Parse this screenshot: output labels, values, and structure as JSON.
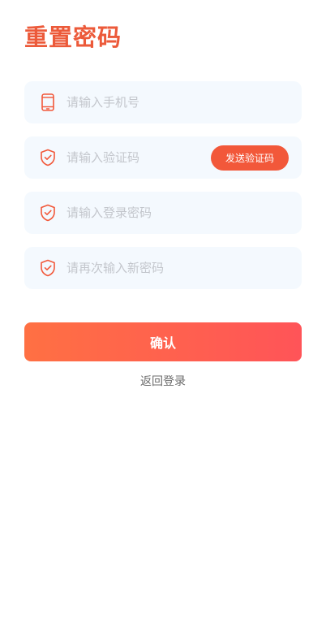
{
  "page": {
    "title": "重置密码"
  },
  "colors": {
    "accent": "#f2583a",
    "title": "#ec5a3a",
    "field_bg": "#f4f9fe",
    "placeholder": "#c3c6cc",
    "button_gradient_start": "#ff7043",
    "button_gradient_end": "#ff5458",
    "link": "#6b6b6b"
  },
  "form": {
    "phone": {
      "placeholder": "请输入手机号",
      "value": "",
      "icon": "phone-icon"
    },
    "code": {
      "placeholder": "请输入验证码",
      "value": "",
      "icon": "shield-check-icon",
      "send_label": "发送验证码"
    },
    "password": {
      "placeholder": "请输入登录密码",
      "value": "",
      "icon": "shield-check-icon"
    },
    "confirm_password": {
      "placeholder": "请再次输入新密码",
      "value": "",
      "icon": "shield-check-icon"
    }
  },
  "actions": {
    "confirm_label": "确认",
    "back_label": "返回登录"
  }
}
